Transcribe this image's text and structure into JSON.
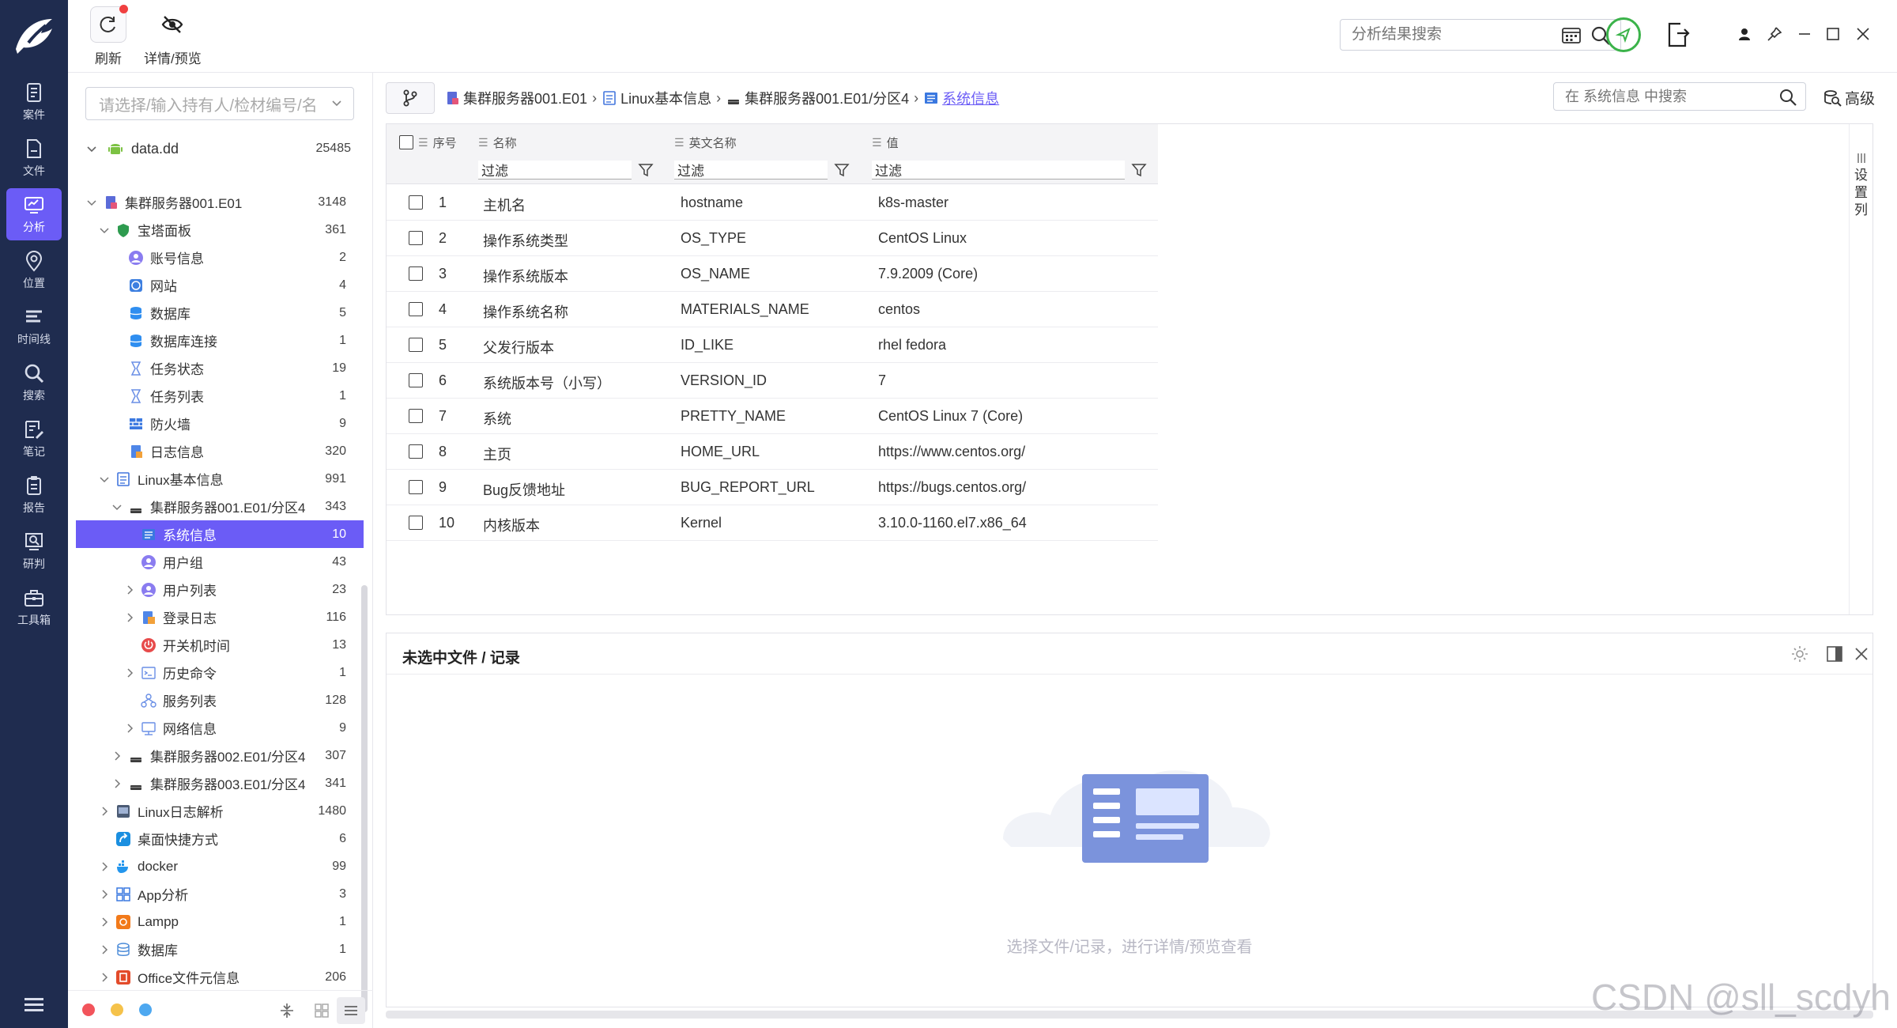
{
  "rail": {
    "items": [
      {
        "label": "案件",
        "icon": "case-icon"
      },
      {
        "label": "文件",
        "icon": "file-icon"
      },
      {
        "label": "分析",
        "icon": "analysis-icon"
      },
      {
        "label": "位置",
        "icon": "location-icon"
      },
      {
        "label": "时间线",
        "icon": "timeline-icon"
      },
      {
        "label": "搜索",
        "icon": "search-icon"
      },
      {
        "label": "笔记",
        "icon": "note-icon"
      },
      {
        "label": "报告",
        "icon": "report-icon"
      },
      {
        "label": "研判",
        "icon": "judge-icon"
      },
      {
        "label": "工具箱",
        "icon": "toolbox-icon"
      }
    ],
    "active_index": 2
  },
  "toolbar": {
    "refresh_label": "刷新",
    "preview_label": "详情/预览",
    "search_placeholder": "分析结果搜索"
  },
  "tree": {
    "select_placeholder": "请选择/输入持有人/检材编号/名",
    "root_label": "data.dd",
    "root_count": "25485",
    "rows": [
      {
        "label": "集群服务器001.E01",
        "count": "3148",
        "indent": 1,
        "caret": "down",
        "icon": "server"
      },
      {
        "label": "宝塔面板",
        "count": "361",
        "indent": 2,
        "caret": "down",
        "icon": "shield"
      },
      {
        "label": "账号信息",
        "count": "2",
        "indent": 3,
        "caret": "",
        "icon": "user"
      },
      {
        "label": "网站",
        "count": "4",
        "indent": 3,
        "caret": "",
        "icon": "web"
      },
      {
        "label": "数据库",
        "count": "5",
        "indent": 3,
        "caret": "",
        "icon": "db"
      },
      {
        "label": "数据库连接",
        "count": "1",
        "indent": 3,
        "caret": "",
        "icon": "db"
      },
      {
        "label": "任务状态",
        "count": "19",
        "indent": 3,
        "caret": "",
        "icon": "hourglass"
      },
      {
        "label": "任务列表",
        "count": "1",
        "indent": 3,
        "caret": "",
        "icon": "hourglass"
      },
      {
        "label": "防火墙",
        "count": "9",
        "indent": 3,
        "caret": "",
        "icon": "firewall"
      },
      {
        "label": "日志信息",
        "count": "320",
        "indent": 3,
        "caret": "",
        "icon": "log"
      },
      {
        "label": "Linux基本信息",
        "count": "991",
        "indent": 2,
        "caret": "down",
        "icon": "doc"
      },
      {
        "label": "集群服务器001.E01/分区4",
        "count": "343",
        "indent": 3,
        "caret": "down",
        "icon": "disk"
      },
      {
        "label": "系统信息",
        "count": "10",
        "indent": 4,
        "caret": "",
        "icon": "sysinfo",
        "selected": true
      },
      {
        "label": "用户组",
        "count": "43",
        "indent": 4,
        "caret": "",
        "icon": "user"
      },
      {
        "label": "用户列表",
        "count": "23",
        "indent": 4,
        "caret": "right",
        "icon": "user"
      },
      {
        "label": "登录日志",
        "count": "116",
        "indent": 4,
        "caret": "right",
        "icon": "login"
      },
      {
        "label": "开关机时间",
        "count": "13",
        "indent": 4,
        "caret": "",
        "icon": "power"
      },
      {
        "label": "历史命令",
        "count": "1",
        "indent": 4,
        "caret": "right",
        "icon": "terminal"
      },
      {
        "label": "服务列表",
        "count": "128",
        "indent": 4,
        "caret": "",
        "icon": "service"
      },
      {
        "label": "网络信息",
        "count": "9",
        "indent": 4,
        "caret": "right",
        "icon": "network"
      },
      {
        "label": "集群服务器002.E01/分区4",
        "count": "307",
        "indent": 3,
        "caret": "right",
        "icon": "disk"
      },
      {
        "label": "集群服务器003.E01/分区4",
        "count": "341",
        "indent": 3,
        "caret": "right",
        "icon": "disk"
      },
      {
        "label": "Linux日志解析",
        "count": "1480",
        "indent": 2,
        "caret": "right",
        "icon": "linuxlog"
      },
      {
        "label": "桌面快捷方式",
        "count": "6",
        "indent": 2,
        "caret": "",
        "icon": "shortcut"
      },
      {
        "label": "docker",
        "count": "99",
        "indent": 2,
        "caret": "right",
        "icon": "docker"
      },
      {
        "label": "App分析",
        "count": "3",
        "indent": 2,
        "caret": "right",
        "icon": "app"
      },
      {
        "label": "Lampp",
        "count": "1",
        "indent": 2,
        "caret": "right",
        "icon": "lampp"
      },
      {
        "label": "数据库",
        "count": "1",
        "indent": 2,
        "caret": "right",
        "icon": "dbgray"
      },
      {
        "label": "Office文件元信息",
        "count": "206",
        "indent": 2,
        "caret": "right",
        "icon": "office"
      }
    ]
  },
  "breadcrumb": [
    {
      "label": "集群服务器001.E01",
      "icon": "server"
    },
    {
      "label": "Linux基本信息",
      "icon": "doc"
    },
    {
      "label": "集群服务器001.E01/分区4",
      "icon": "disk"
    },
    {
      "label": "系统信息",
      "icon": "sysinfo"
    }
  ],
  "inner_search_placeholder": "在 系统信息 中搜索",
  "advanced_label": "高级",
  "grid": {
    "columns": [
      "序号",
      "名称",
      "英文名称",
      "值"
    ],
    "filter_label": "过滤",
    "settings_label": "设置列",
    "rows": [
      {
        "no": "1",
        "name": "主机名",
        "en": "hostname",
        "value": "k8s-master"
      },
      {
        "no": "2",
        "name": "操作系统类型",
        "en": "OS_TYPE",
        "value": "CentOS Linux"
      },
      {
        "no": "3",
        "name": "操作系统版本",
        "en": "OS_NAME",
        "value": "7.9.2009 (Core)"
      },
      {
        "no": "4",
        "name": "操作系统名称",
        "en": "MATERIALS_NAME",
        "value": "centos"
      },
      {
        "no": "5",
        "name": "父发行版本",
        "en": "ID_LIKE",
        "value": "rhel fedora"
      },
      {
        "no": "6",
        "name": "系统版本号（小写）",
        "en": "VERSION_ID",
        "value": "7"
      },
      {
        "no": "7",
        "name": "系统",
        "en": "PRETTY_NAME",
        "value": "CentOS Linux 7 (Core)"
      },
      {
        "no": "8",
        "name": "主页",
        "en": "HOME_URL",
        "value": "https://www.centos.org/"
      },
      {
        "no": "9",
        "name": "Bug反馈地址",
        "en": "BUG_REPORT_URL",
        "value": "https://bugs.centos.org/"
      },
      {
        "no": "10",
        "name": "内核版本",
        "en": "Kernel",
        "value": "3.10.0-1160.el7.x86_64"
      }
    ]
  },
  "detail": {
    "title": "未选中文件 / 记录",
    "hint": "选择文件/记录，进行详情/预览查看"
  },
  "watermark": "CSDN @sll_scdyh",
  "colors": {
    "rail_bg": "#1f2c4f",
    "accent": "#6b5cf6",
    "status_green": "#3bb34a"
  }
}
